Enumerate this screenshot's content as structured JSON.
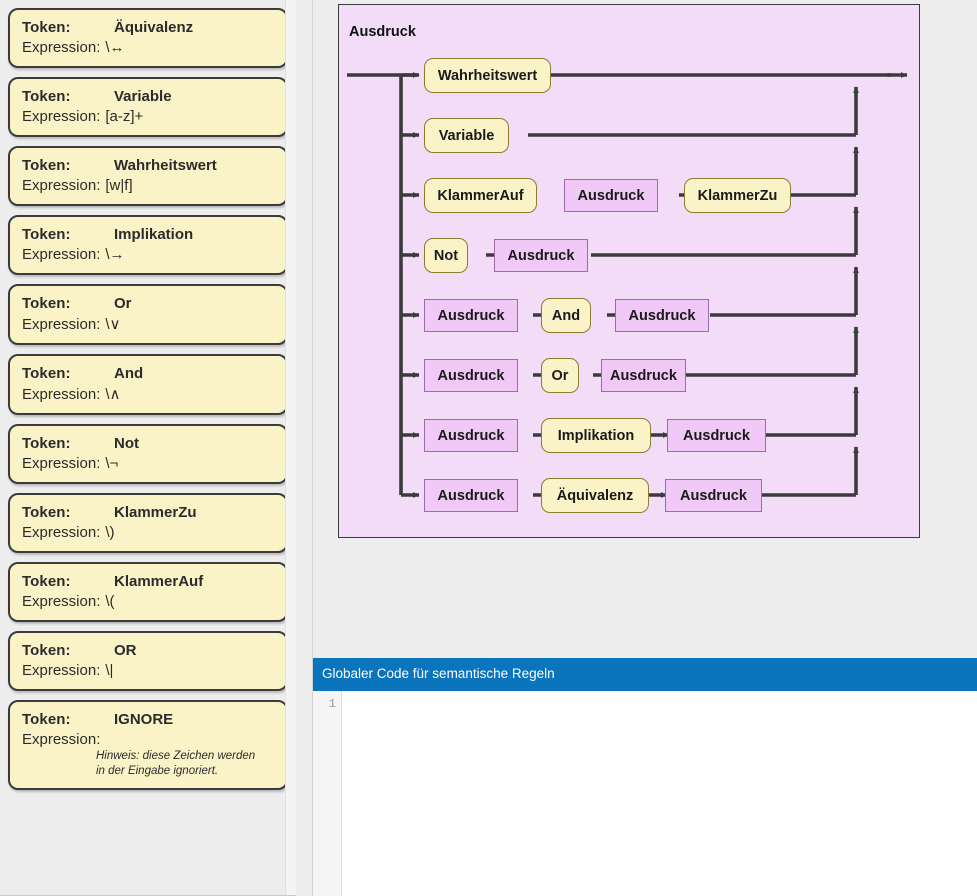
{
  "sidebar": {
    "label_token": "Token:",
    "label_expression": "Expression:",
    "tokens": [
      {
        "name": "Äquivalenz",
        "expression": "\\↔"
      },
      {
        "name": "Variable",
        "expression": "[a-z]+"
      },
      {
        "name": "Wahrheitswert",
        "expression": "[w|f]"
      },
      {
        "name": "Implikation",
        "expression": "\\→"
      },
      {
        "name": "Or",
        "expression": "\\∨"
      },
      {
        "name": "And",
        "expression": "\\∧"
      },
      {
        "name": "Not",
        "expression": "\\¬"
      },
      {
        "name": "KlammerZu",
        "expression": "\\)"
      },
      {
        "name": "KlammerAuf",
        "expression": "\\("
      },
      {
        "name": "OR",
        "expression": "\\|"
      },
      {
        "name": "IGNORE",
        "expression": "",
        "note_line1": "Hinweis: diese Zeichen werden",
        "note_line2": "in der Eingabe ignoriert."
      }
    ]
  },
  "diagram": {
    "title": "Ausdruck",
    "panel_color": "#f2dcf8",
    "terminal_color": "#fbf3c8",
    "nonterminal_color": "#f0c9f7",
    "line_color": "#3b3b3b",
    "rows": [
      {
        "nodes": [
          {
            "label": "Wahrheitswert",
            "kind": "terminal"
          }
        ]
      },
      {
        "nodes": [
          {
            "label": "Variable",
            "kind": "terminal"
          }
        ]
      },
      {
        "nodes": [
          {
            "label": "KlammerAuf",
            "kind": "terminal"
          },
          {
            "label": "Ausdruck",
            "kind": "nonterminal"
          },
          {
            "label": "KlammerZu",
            "kind": "terminal"
          }
        ]
      },
      {
        "nodes": [
          {
            "label": "Not",
            "kind": "terminal"
          },
          {
            "label": "Ausdruck",
            "kind": "nonterminal"
          }
        ]
      },
      {
        "nodes": [
          {
            "label": "Ausdruck",
            "kind": "nonterminal"
          },
          {
            "label": "And",
            "kind": "terminal"
          },
          {
            "label": "Ausdruck",
            "kind": "nonterminal"
          }
        ]
      },
      {
        "nodes": [
          {
            "label": "Ausdruck",
            "kind": "nonterminal"
          },
          {
            "label": "Or",
            "kind": "terminal"
          },
          {
            "label": "Ausdruck",
            "kind": "nonterminal"
          }
        ]
      },
      {
        "nodes": [
          {
            "label": "Ausdruck",
            "kind": "nonterminal"
          },
          {
            "label": "Implikation",
            "kind": "terminal"
          },
          {
            "label": "Ausdruck",
            "kind": "nonterminal"
          }
        ]
      },
      {
        "nodes": [
          {
            "label": "Ausdruck",
            "kind": "nonterminal"
          },
          {
            "label": "Äquivalenz",
            "kind": "terminal"
          },
          {
            "label": "Ausdruck",
            "kind": "nonterminal"
          }
        ]
      }
    ]
  },
  "code_panel": {
    "header_title": "Globaler Code für semantische Regeln",
    "header_color": "#0a74bd",
    "line_numbers": [
      "1"
    ],
    "content": ""
  }
}
